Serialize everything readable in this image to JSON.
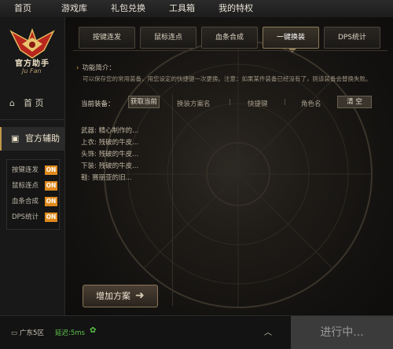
{
  "topnav": {
    "items": [
      "首页",
      "游戏库",
      "礼包兑换",
      "工具箱",
      "我的特权"
    ]
  },
  "sidebar": {
    "logo_text": "官方助手",
    "logo_sign": "Ju Fan",
    "home_label": "首  页",
    "assist_label": "官方辅助",
    "sub_items": [
      {
        "label": "按键连发",
        "tag": "ON"
      },
      {
        "label": "鼠标连点",
        "tag": "ON"
      },
      {
        "label": "血条合成",
        "tag": "ON"
      },
      {
        "label": "DPS统计",
        "tag": "ON"
      }
    ]
  },
  "tabs": [
    "按键连发",
    "鼠标连点",
    "血条合成",
    "一键换装",
    "DPS统计"
  ],
  "active_tab": "一键换装",
  "intro": {
    "title": "功能简介：",
    "text": "可以保存您的常用装备，用您设定的快捷键一次更换。注意：如果某件装备已经没有了，则该装备会替换失败。"
  },
  "equip_panel": {
    "current_label": "当前装备：",
    "get_button": "获取当前",
    "items": [
      "武器: 精心制作的...",
      "上衣: 残破的牛皮...",
      "头饰: 残破的牛皮...",
      "下装: 残破的牛皮...",
      "鞋: 赛丽亚的旧..."
    ],
    "add_button": "增加方案"
  },
  "plan_table": {
    "col_name": "换装方案名",
    "col_hotkey": "快捷键",
    "col_role": "角色名",
    "clear_button": "清 空"
  },
  "status": {
    "server": "广东5区",
    "ping": "延迟:5ms",
    "running": "进行中..."
  },
  "colors": {
    "accent_orange": "#e08a1c",
    "ping_green": "#5cc24a",
    "gold_border": "#8c7a58"
  }
}
